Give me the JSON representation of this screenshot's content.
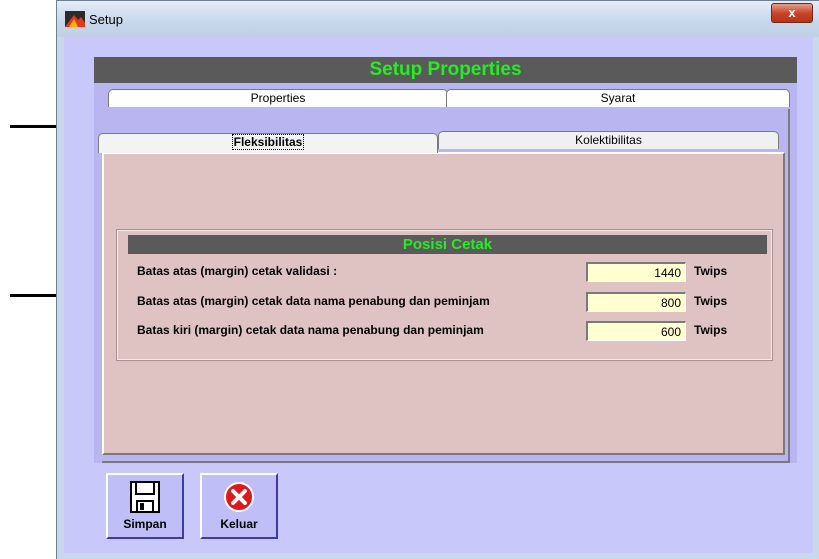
{
  "window": {
    "title": "Setup",
    "close_label": "x"
  },
  "panel": {
    "header": "Setup Properties"
  },
  "tabs": {
    "back": [
      "Properties",
      "Syarat"
    ],
    "front": [
      "Fleksibilitas",
      "Kolektibilitas"
    ],
    "active": "Fleksibilitas"
  },
  "group": {
    "title": "Posisi Cetak",
    "rows": [
      {
        "label": "Batas atas (margin) cetak validasi :",
        "value": "1440",
        "unit": "Twips"
      },
      {
        "label": "Batas atas (margin) cetak data nama penabung dan peminjam",
        "value": "800",
        "unit": "Twips"
      },
      {
        "label": "Batas kiri (margin) cetak data nama penabung dan peminjam",
        "value": "600",
        "unit": "Twips"
      }
    ]
  },
  "buttons": {
    "save": "Simpan",
    "exit": "Keluar"
  },
  "icons": {
    "app": "setup-app-icon",
    "save": "floppy-disk-icon",
    "exit": "red-x-circle-icon"
  },
  "colors": {
    "header_bg": "#5a5a5a",
    "header_text": "#22ee22",
    "content_bg": "#dfc2c2",
    "input_bg": "#ffffd2"
  }
}
